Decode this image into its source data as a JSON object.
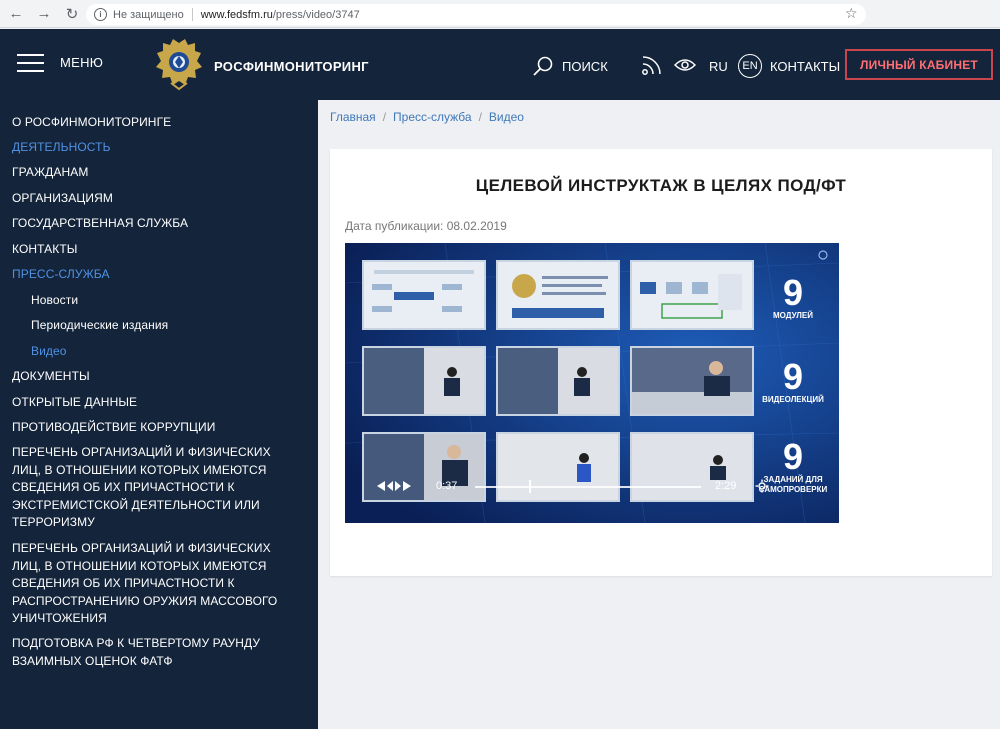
{
  "browser": {
    "security_label": "Не защищено",
    "url_host": "www.fedsfm.ru",
    "url_path": "/press/video/3747"
  },
  "header": {
    "menu_label": "МЕНЮ",
    "brand": "РОСФИНМОНИТОРИНГ",
    "search_label": "ПОИСК",
    "lang_ru": "RU",
    "lang_en": "EN",
    "contacts_label": "КОНТАКТЫ",
    "cabinet_label": "ЛИЧНЫЙ КАБИНЕТ",
    "accent_color": "#c9464f"
  },
  "sidebar": {
    "items": [
      {
        "label": "О РОСФИНМОНИТОРИНГЕ"
      },
      {
        "label": "ДЕЯТЕЛЬНОСТЬ"
      },
      {
        "label": "ГРАЖДАНАМ"
      },
      {
        "label": "ОРГАНИЗАЦИЯМ"
      },
      {
        "label": "ГОСУДАРСТВЕННАЯ СЛУЖБА"
      },
      {
        "label": "КОНТАКТЫ"
      },
      {
        "label": "ПРЕСС-СЛУЖБА"
      },
      {
        "label": "Новости"
      },
      {
        "label": "Периодические издания"
      },
      {
        "label": "Видео"
      },
      {
        "label": "ДОКУМЕНТЫ"
      },
      {
        "label": "ОТКРЫТЫЕ ДАННЫЕ"
      },
      {
        "label": "ПРОТИВОДЕЙСТВИЕ КОРРУПЦИИ"
      },
      {
        "label": "ПЕРЕЧЕНЬ ОРГАНИЗАЦИЙ И ФИЗИЧЕСКИХ ЛИЦ, В ОТНОШЕНИИ КОТОРЫХ ИМЕЮТСЯ СВЕДЕНИЯ ОБ ИХ ПРИЧАСТНОСТИ К ЭКСТРЕМИСТСКОЙ ДЕЯТЕЛЬНОСТИ ИЛИ ТЕРРОРИЗМУ"
      },
      {
        "label": "ПЕРЕЧЕНЬ ОРГАНИЗАЦИЙ И ФИЗИЧЕСКИХ ЛИЦ, В ОТНОШЕНИИ КОТОРЫХ ИМЕЮТСЯ СВЕДЕНИЯ ОБ ИХ ПРИЧАСТНОСТИ К РАСПРОСТРАНЕНИЮ ОРУЖИЯ МАССОВОГО УНИЧТОЖЕНИЯ"
      },
      {
        "label": "ПОДГОТОВКА РФ К ЧЕТВЕРТОМУ РАУНДУ ВЗАИМНЫХ ОЦЕНОК ФАТФ"
      }
    ],
    "active_color": "#4f92e4"
  },
  "breadcrumbs": [
    "Главная",
    "Пресс-служба",
    "Видео"
  ],
  "article": {
    "title": "ЦЕЛЕВОЙ ИНСТРУКТАЖ В ЦЕЛЯХ ПОД/ФТ",
    "pub_date": "Дата публикации: 08.02.2019"
  },
  "video": {
    "stats": [
      {
        "num": "9",
        "label": "МОДУЛЕЙ"
      },
      {
        "num": "9",
        "label": "ВИДЕОЛЕКЦИЙ"
      },
      {
        "num": "9",
        "label": "ЗАДАНИЙ ДЛЯ САМОПРОВЕРКИ"
      }
    ],
    "time_current": "0:37",
    "time_total": "2:29",
    "progress": 0.24
  }
}
